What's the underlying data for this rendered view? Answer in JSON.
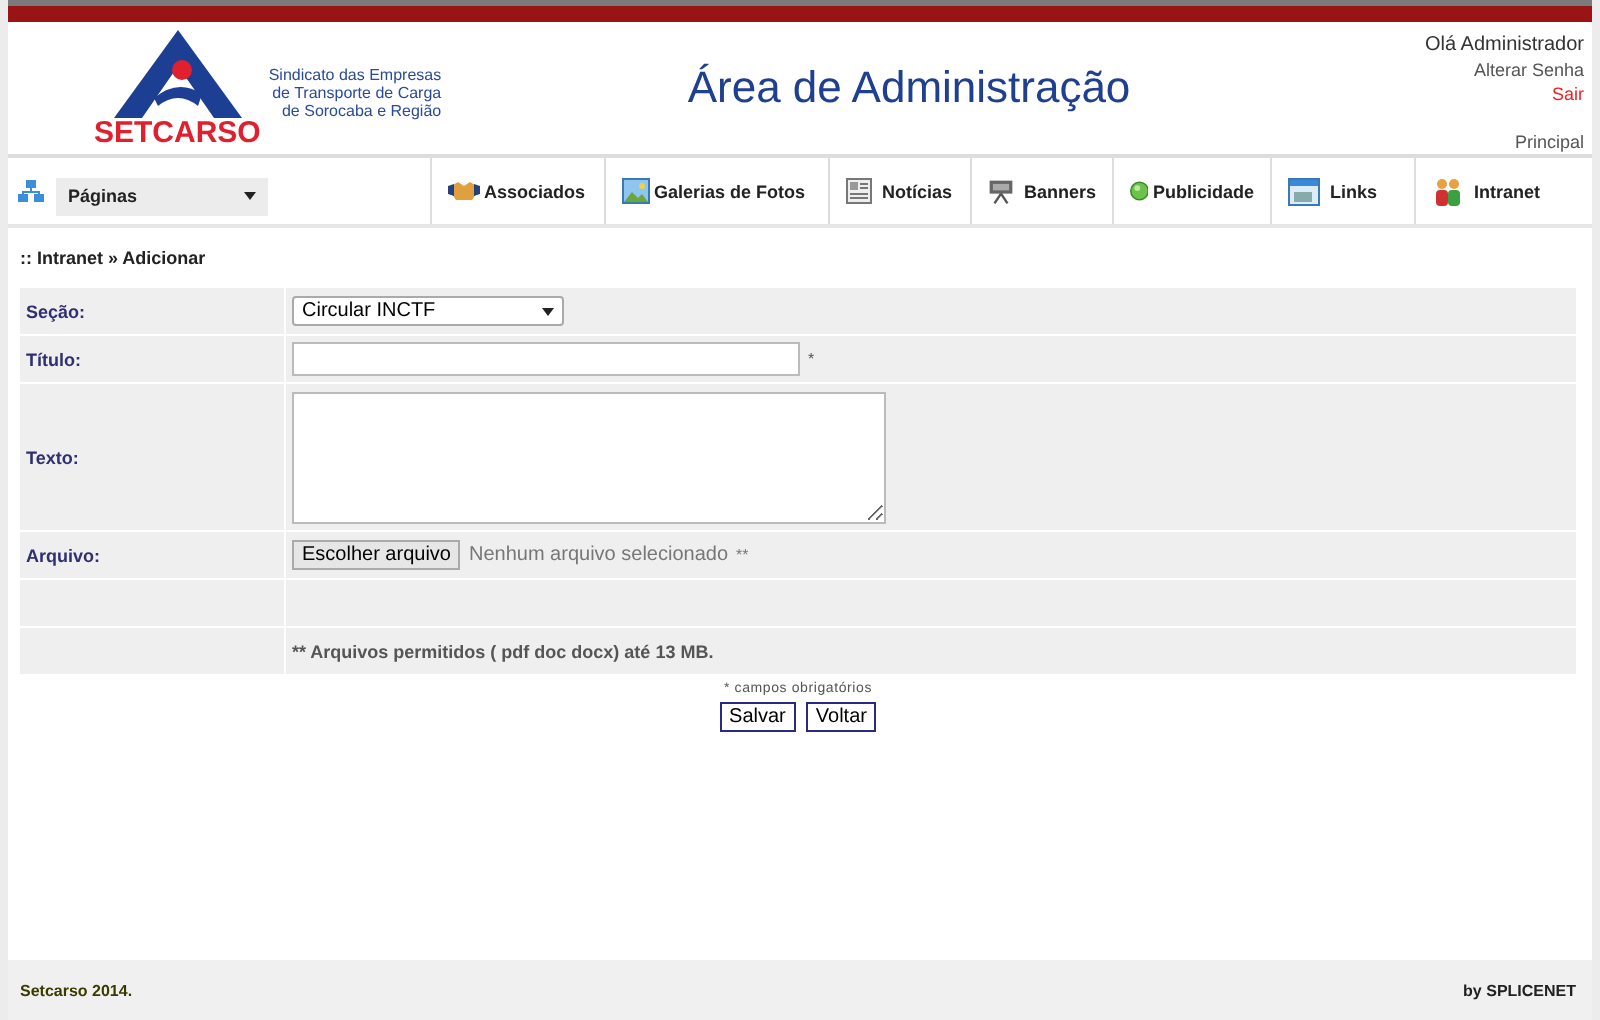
{
  "logo": {
    "name": "SETCARSO",
    "tagline": [
      "Sindicato das Empresas",
      "de Transporte de Carga",
      "de Sorocaba e Região"
    ]
  },
  "header": {
    "title": "Área de Administração",
    "greeting": "Olá Administrador",
    "change_password": "Alterar Senha",
    "logout": "Sair",
    "home": "Principal"
  },
  "nav": {
    "pages_select": "Páginas",
    "items": [
      {
        "label": "Associados"
      },
      {
        "label": "Galerias de Fotos"
      },
      {
        "label": "Notícias"
      },
      {
        "label": "Banners"
      },
      {
        "label": "Publicidade"
      },
      {
        "label": "Links"
      },
      {
        "label": "Intranet"
      }
    ]
  },
  "breadcrumb": ":: Intranet » Adicionar",
  "form": {
    "rows": [
      {
        "kind": "select",
        "label": "Seção:",
        "value": "Circular INCTF"
      },
      {
        "kind": "text",
        "label": "Título:",
        "required_mark": "*"
      },
      {
        "kind": "textarea",
        "label": "Texto:"
      },
      {
        "kind": "file",
        "label": "Arquivo:",
        "button": "Escolher arquivo",
        "status": "Nenhum arquivo selecionado",
        "note_mark": "**"
      },
      {
        "kind": "blank"
      },
      {
        "kind": "note",
        "text": "** Arquivos permitidos ( pdf doc docx) até 13 MB."
      }
    ],
    "required_note": "* campos obrigatórios",
    "buttons": [
      "Salvar",
      "Voltar"
    ]
  },
  "footer": {
    "left": "Setcarso 2014.",
    "right": "by SPLICENET"
  }
}
